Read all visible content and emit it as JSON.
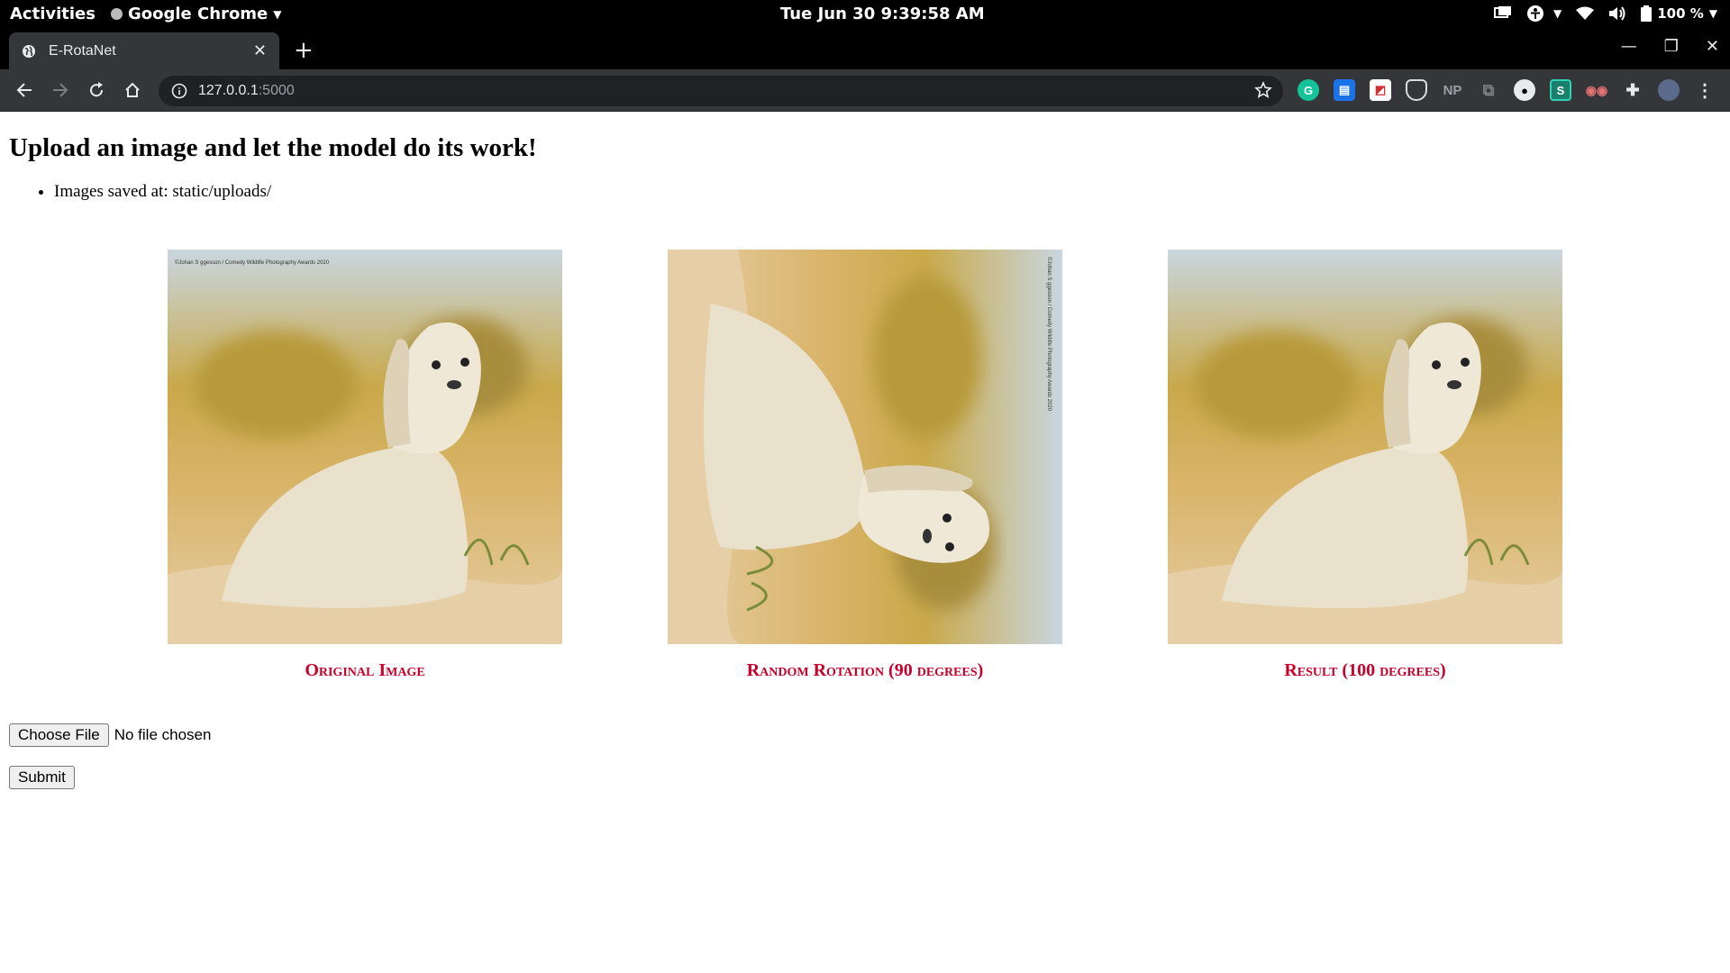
{
  "system_bar": {
    "activities": "Activities",
    "app_name": "Google Chrome",
    "clock": "Tue Jun 30   9:39:58 AM",
    "battery": "100 %"
  },
  "browser": {
    "tab_title": "E-RotaNet",
    "url_host": "127.0.0.1",
    "url_port": ":5000",
    "extension_np": "NP",
    "extension_s": "S"
  },
  "page": {
    "heading": "Upload an image and let the model do its work!",
    "info_item": "Images saved at: static/uploads/",
    "figures": [
      {
        "caption": "Original Image",
        "watermark": "©Johan S ggesson / Comedy Wildlife Photography Awards 2020",
        "rotation_deg": 0
      },
      {
        "caption": "Random Rotation (90 degrees)",
        "watermark": "©Johan S ggesson / Comedy Wildlife Photography Awards 2020",
        "rotation_deg": 90
      },
      {
        "caption": "Result (100 degrees)",
        "rotation_deg": 0
      }
    ],
    "file_input": {
      "button_label": "Choose File",
      "status": "No file chosen"
    },
    "submit_label": "Submit"
  },
  "colors": {
    "caption": "#c8002a",
    "sand": "#e6cfa6",
    "grass": "#c9a94a"
  }
}
